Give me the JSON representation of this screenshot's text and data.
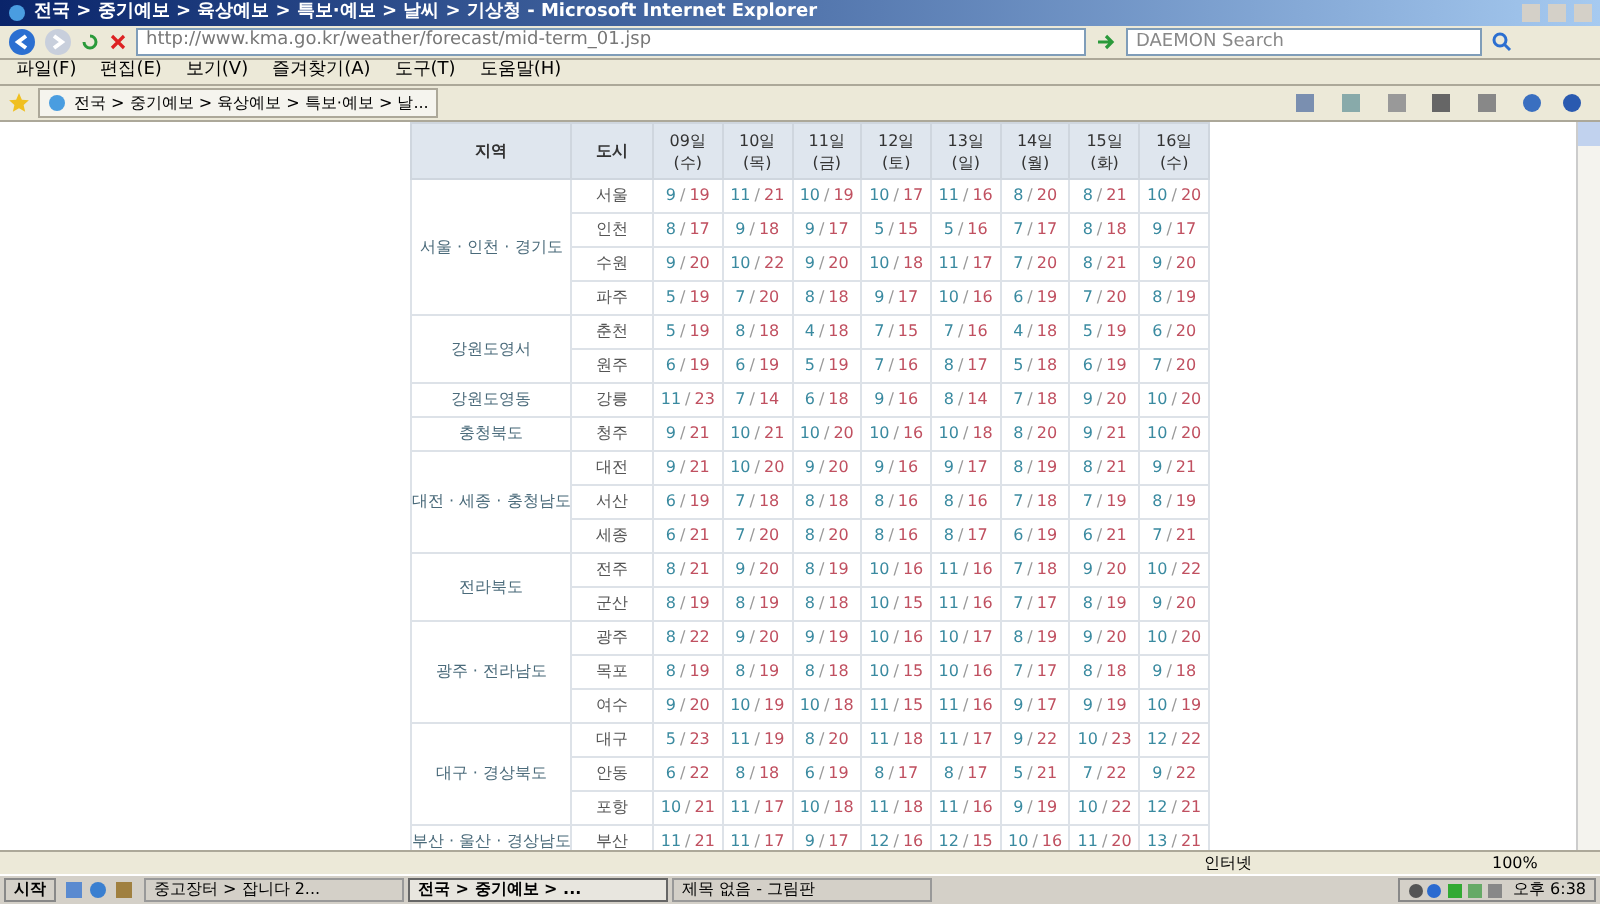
{
  "window": {
    "title": "전국 > 중기예보 > 육상예보 > 특보·예보 > 날씨 > 기상청 - Microsoft Internet Explorer"
  },
  "address": {
    "value": "http://www.kma.go.kr/weather/forecast/mid-term_01.jsp"
  },
  "search": {
    "placeholder": "DAEMON Search"
  },
  "menu": [
    "파일(F)",
    "편집(E)",
    "보기(V)",
    "즐겨찾기(A)",
    "도구(T)",
    "도움말(H)"
  ],
  "tab": {
    "title": "전국 > 중기예보 > 육상예보 > 특보·예보 > 날..."
  },
  "table": {
    "region_header": "지역",
    "city_header": "도시",
    "separator": "/",
    "days": [
      {
        "date": "09일",
        "weekday": "(수)"
      },
      {
        "date": "10일",
        "weekday": "(목)"
      },
      {
        "date": "11일",
        "weekday": "(금)"
      },
      {
        "date": "12일",
        "weekday": "(토)"
      },
      {
        "date": "13일",
        "weekday": "(일)"
      },
      {
        "date": "14일",
        "weekday": "(월)"
      },
      {
        "date": "15일",
        "weekday": "(화)"
      },
      {
        "date": "16일",
        "weekday": "(수)"
      }
    ],
    "groups": [
      {
        "region": "서울 · 인천 · 경기도",
        "cities": [
          {
            "name": "서울",
            "temps": [
              [
                "9",
                "19"
              ],
              [
                "11",
                "21"
              ],
              [
                "10",
                "19"
              ],
              [
                "10",
                "17"
              ],
              [
                "11",
                "16"
              ],
              [
                "8",
                "20"
              ],
              [
                "8",
                "21"
              ],
              [
                "10",
                "20"
              ]
            ]
          },
          {
            "name": "인천",
            "temps": [
              [
                "8",
                "17"
              ],
              [
                "9",
                "18"
              ],
              [
                "9",
                "17"
              ],
              [
                "5",
                "15"
              ],
              [
                "5",
                "16"
              ],
              [
                "7",
                "17"
              ],
              [
                "8",
                "18"
              ],
              [
                "9",
                "17"
              ]
            ]
          },
          {
            "name": "수원",
            "temps": [
              [
                "9",
                "20"
              ],
              [
                "10",
                "22"
              ],
              [
                "9",
                "20"
              ],
              [
                "10",
                "18"
              ],
              [
                "11",
                "17"
              ],
              [
                "7",
                "20"
              ],
              [
                "8",
                "21"
              ],
              [
                "9",
                "20"
              ]
            ]
          },
          {
            "name": "파주",
            "temps": [
              [
                "5",
                "19"
              ],
              [
                "7",
                "20"
              ],
              [
                "8",
                "18"
              ],
              [
                "9",
                "17"
              ],
              [
                "10",
                "16"
              ],
              [
                "6",
                "19"
              ],
              [
                "7",
                "20"
              ],
              [
                "8",
                "19"
              ]
            ]
          }
        ]
      },
      {
        "region": "강원도영서",
        "cities": [
          {
            "name": "춘천",
            "temps": [
              [
                "5",
                "19"
              ],
              [
                "8",
                "18"
              ],
              [
                "4",
                "18"
              ],
              [
                "7",
                "15"
              ],
              [
                "7",
                "16"
              ],
              [
                "4",
                "18"
              ],
              [
                "5",
                "19"
              ],
              [
                "6",
                "20"
              ]
            ]
          },
          {
            "name": "원주",
            "temps": [
              [
                "6",
                "19"
              ],
              [
                "6",
                "19"
              ],
              [
                "5",
                "19"
              ],
              [
                "7",
                "16"
              ],
              [
                "8",
                "17"
              ],
              [
                "5",
                "18"
              ],
              [
                "6",
                "19"
              ],
              [
                "7",
                "20"
              ]
            ]
          }
        ]
      },
      {
        "region": "강원도영동",
        "cities": [
          {
            "name": "강릉",
            "temps": [
              [
                "11",
                "23"
              ],
              [
                "7",
                "14"
              ],
              [
                "6",
                "18"
              ],
              [
                "9",
                "16"
              ],
              [
                "8",
                "14"
              ],
              [
                "7",
                "18"
              ],
              [
                "9",
                "20"
              ],
              [
                "10",
                "20"
              ]
            ]
          }
        ]
      },
      {
        "region": "충청북도",
        "cities": [
          {
            "name": "청주",
            "temps": [
              [
                "9",
                "21"
              ],
              [
                "10",
                "21"
              ],
              [
                "10",
                "20"
              ],
              [
                "10",
                "16"
              ],
              [
                "10",
                "18"
              ],
              [
                "8",
                "20"
              ],
              [
                "9",
                "21"
              ],
              [
                "10",
                "20"
              ]
            ]
          }
        ]
      },
      {
        "region": "대전 · 세종 · 충청남도",
        "cities": [
          {
            "name": "대전",
            "temps": [
              [
                "9",
                "21"
              ],
              [
                "10",
                "20"
              ],
              [
                "9",
                "20"
              ],
              [
                "9",
                "16"
              ],
              [
                "9",
                "17"
              ],
              [
                "8",
                "19"
              ],
              [
                "8",
                "21"
              ],
              [
                "9",
                "21"
              ]
            ]
          },
          {
            "name": "서산",
            "temps": [
              [
                "6",
                "19"
              ],
              [
                "7",
                "18"
              ],
              [
                "8",
                "18"
              ],
              [
                "8",
                "16"
              ],
              [
                "8",
                "16"
              ],
              [
                "7",
                "18"
              ],
              [
                "7",
                "19"
              ],
              [
                "8",
                "19"
              ]
            ]
          },
          {
            "name": "세종",
            "temps": [
              [
                "6",
                "21"
              ],
              [
                "7",
                "20"
              ],
              [
                "8",
                "20"
              ],
              [
                "8",
                "16"
              ],
              [
                "8",
                "17"
              ],
              [
                "6",
                "19"
              ],
              [
                "6",
                "21"
              ],
              [
                "7",
                "21"
              ]
            ]
          }
        ]
      },
      {
        "region": "전라북도",
        "cities": [
          {
            "name": "전주",
            "temps": [
              [
                "8",
                "21"
              ],
              [
                "9",
                "20"
              ],
              [
                "8",
                "19"
              ],
              [
                "10",
                "16"
              ],
              [
                "11",
                "16"
              ],
              [
                "7",
                "18"
              ],
              [
                "9",
                "20"
              ],
              [
                "10",
                "22"
              ]
            ]
          },
          {
            "name": "군산",
            "temps": [
              [
                "8",
                "19"
              ],
              [
                "8",
                "19"
              ],
              [
                "8",
                "18"
              ],
              [
                "10",
                "15"
              ],
              [
                "11",
                "16"
              ],
              [
                "7",
                "17"
              ],
              [
                "8",
                "19"
              ],
              [
                "9",
                "20"
              ]
            ]
          }
        ]
      },
      {
        "region": "광주 · 전라남도",
        "cities": [
          {
            "name": "광주",
            "temps": [
              [
                "8",
                "22"
              ],
              [
                "9",
                "20"
              ],
              [
                "9",
                "19"
              ],
              [
                "10",
                "16"
              ],
              [
                "10",
                "17"
              ],
              [
                "8",
                "19"
              ],
              [
                "9",
                "20"
              ],
              [
                "10",
                "20"
              ]
            ]
          },
          {
            "name": "목포",
            "temps": [
              [
                "8",
                "19"
              ],
              [
                "8",
                "19"
              ],
              [
                "8",
                "18"
              ],
              [
                "10",
                "15"
              ],
              [
                "10",
                "16"
              ],
              [
                "7",
                "17"
              ],
              [
                "8",
                "18"
              ],
              [
                "9",
                "18"
              ]
            ]
          },
          {
            "name": "여수",
            "temps": [
              [
                "9",
                "20"
              ],
              [
                "10",
                "19"
              ],
              [
                "10",
                "18"
              ],
              [
                "11",
                "15"
              ],
              [
                "11",
                "16"
              ],
              [
                "9",
                "17"
              ],
              [
                "9",
                "19"
              ],
              [
                "10",
                "19"
              ]
            ]
          }
        ]
      },
      {
        "region": "대구 · 경상북도",
        "cities": [
          {
            "name": "대구",
            "temps": [
              [
                "5",
                "23"
              ],
              [
                "11",
                "19"
              ],
              [
                "8",
                "20"
              ],
              [
                "11",
                "18"
              ],
              [
                "11",
                "17"
              ],
              [
                "9",
                "22"
              ],
              [
                "10",
                "23"
              ],
              [
                "12",
                "22"
              ]
            ]
          },
          {
            "name": "안동",
            "temps": [
              [
                "6",
                "22"
              ],
              [
                "8",
                "18"
              ],
              [
                "6",
                "19"
              ],
              [
                "8",
                "17"
              ],
              [
                "8",
                "17"
              ],
              [
                "5",
                "21"
              ],
              [
                "7",
                "22"
              ],
              [
                "9",
                "22"
              ]
            ]
          },
          {
            "name": "포항",
            "temps": [
              [
                "10",
                "21"
              ],
              [
                "11",
                "17"
              ],
              [
                "10",
                "18"
              ],
              [
                "11",
                "18"
              ],
              [
                "11",
                "16"
              ],
              [
                "9",
                "19"
              ],
              [
                "10",
                "22"
              ],
              [
                "12",
                "21"
              ]
            ]
          }
        ]
      },
      {
        "region": "부산 · 울산 · 경상남도",
        "cities": [
          {
            "name": "부산",
            "temps": [
              [
                "11",
                "21"
              ],
              [
                "11",
                "17"
              ],
              [
                "9",
                "17"
              ],
              [
                "12",
                "16"
              ],
              [
                "12",
                "15"
              ],
              [
                "10",
                "16"
              ],
              [
                "11",
                "20"
              ],
              [
                "13",
                "21"
              ]
            ]
          }
        ]
      }
    ]
  },
  "status_bar": {
    "zone": "인터넷",
    "zoom": "100%"
  },
  "taskbar": {
    "start": "시작",
    "clock": "오후 6:38",
    "items": [
      {
        "label": "중고장터 > 잡니다 2...",
        "selected": false
      },
      {
        "label": "전국 > 중기예보 > ...",
        "selected": true
      },
      {
        "label": "제목 없음 - 그림판",
        "selected": false
      }
    ]
  }
}
